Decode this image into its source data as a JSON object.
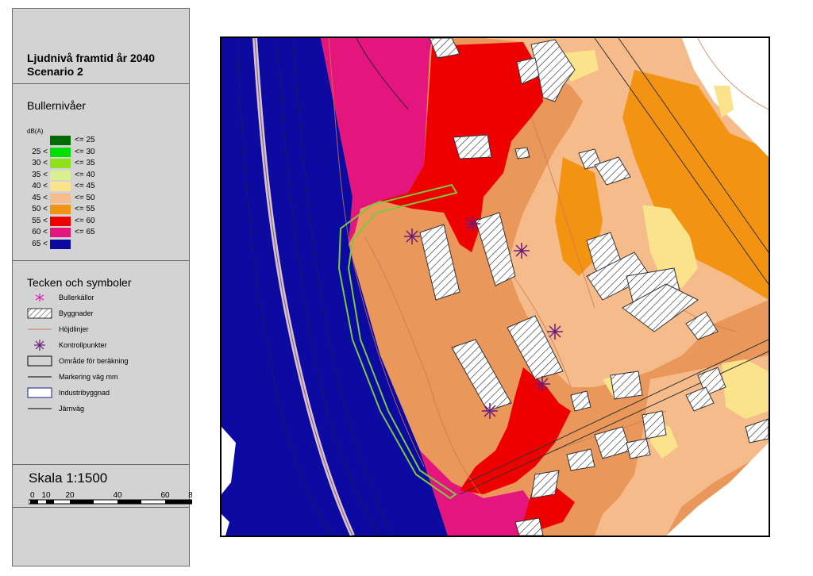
{
  "title": {
    "line1": "Ljudnivå framtid år 2040",
    "line2": "Scenario 2"
  },
  "legend": {
    "heading": "Bullernivåer",
    "unit": "dB(A)",
    "levels": [
      {
        "lower": "",
        "upper": "<= 25",
        "color": "#006b00"
      },
      {
        "lower": "25 <",
        "upper": "<= 30",
        "color": "#00e000"
      },
      {
        "lower": "30 <",
        "upper": "<= 35",
        "color": "#8ee21a"
      },
      {
        "lower": "35 <",
        "upper": "<= 40",
        "color": "#d8f08e"
      },
      {
        "lower": "40 <",
        "upper": "<= 45",
        "color": "#fae38a"
      },
      {
        "lower": "45 <",
        "upper": "<= 50",
        "color": "#f6bb8a"
      },
      {
        "lower": "50 <",
        "upper": "<= 55",
        "color": "#f39312"
      },
      {
        "lower": "55 <",
        "upper": "<= 60",
        "color": "#ee0000"
      },
      {
        "lower": "60 <",
        "upper": "<= 65",
        "color": "#e4157c"
      },
      {
        "lower": "65 <",
        "upper": "",
        "color": "#0c0aa0"
      }
    ]
  },
  "symbols": {
    "heading": "Tecken och symboler",
    "items": [
      {
        "label": "Bullerkällor",
        "icon": "noise-source-star-icon"
      },
      {
        "label": "Byggnader",
        "icon": "building-hatch-icon"
      },
      {
        "label": "Höjdlinjer",
        "icon": "contour-line-icon"
      },
      {
        "label": "Kontrollpunkter",
        "icon": "control-point-star-icon"
      },
      {
        "label": "Område för beräkning",
        "icon": "calc-area-box-icon"
      },
      {
        "label": "Markering väg mm",
        "icon": "road-marking-line-icon"
      },
      {
        "label": "Industribyggnad",
        "icon": "industrial-building-box-icon"
      },
      {
        "label": "Järnväg",
        "icon": "railway-line-icon"
      }
    ]
  },
  "scale": {
    "label": "Skala 1:1500",
    "ticks": [
      "0",
      "10",
      "20",
      "40",
      "60",
      "8"
    ]
  },
  "colors": {
    "panel_bg": "#d3d3d3",
    "contour": "#c97a5a",
    "calc_area": "#7ac943",
    "control_point": "#6a1b7a"
  }
}
